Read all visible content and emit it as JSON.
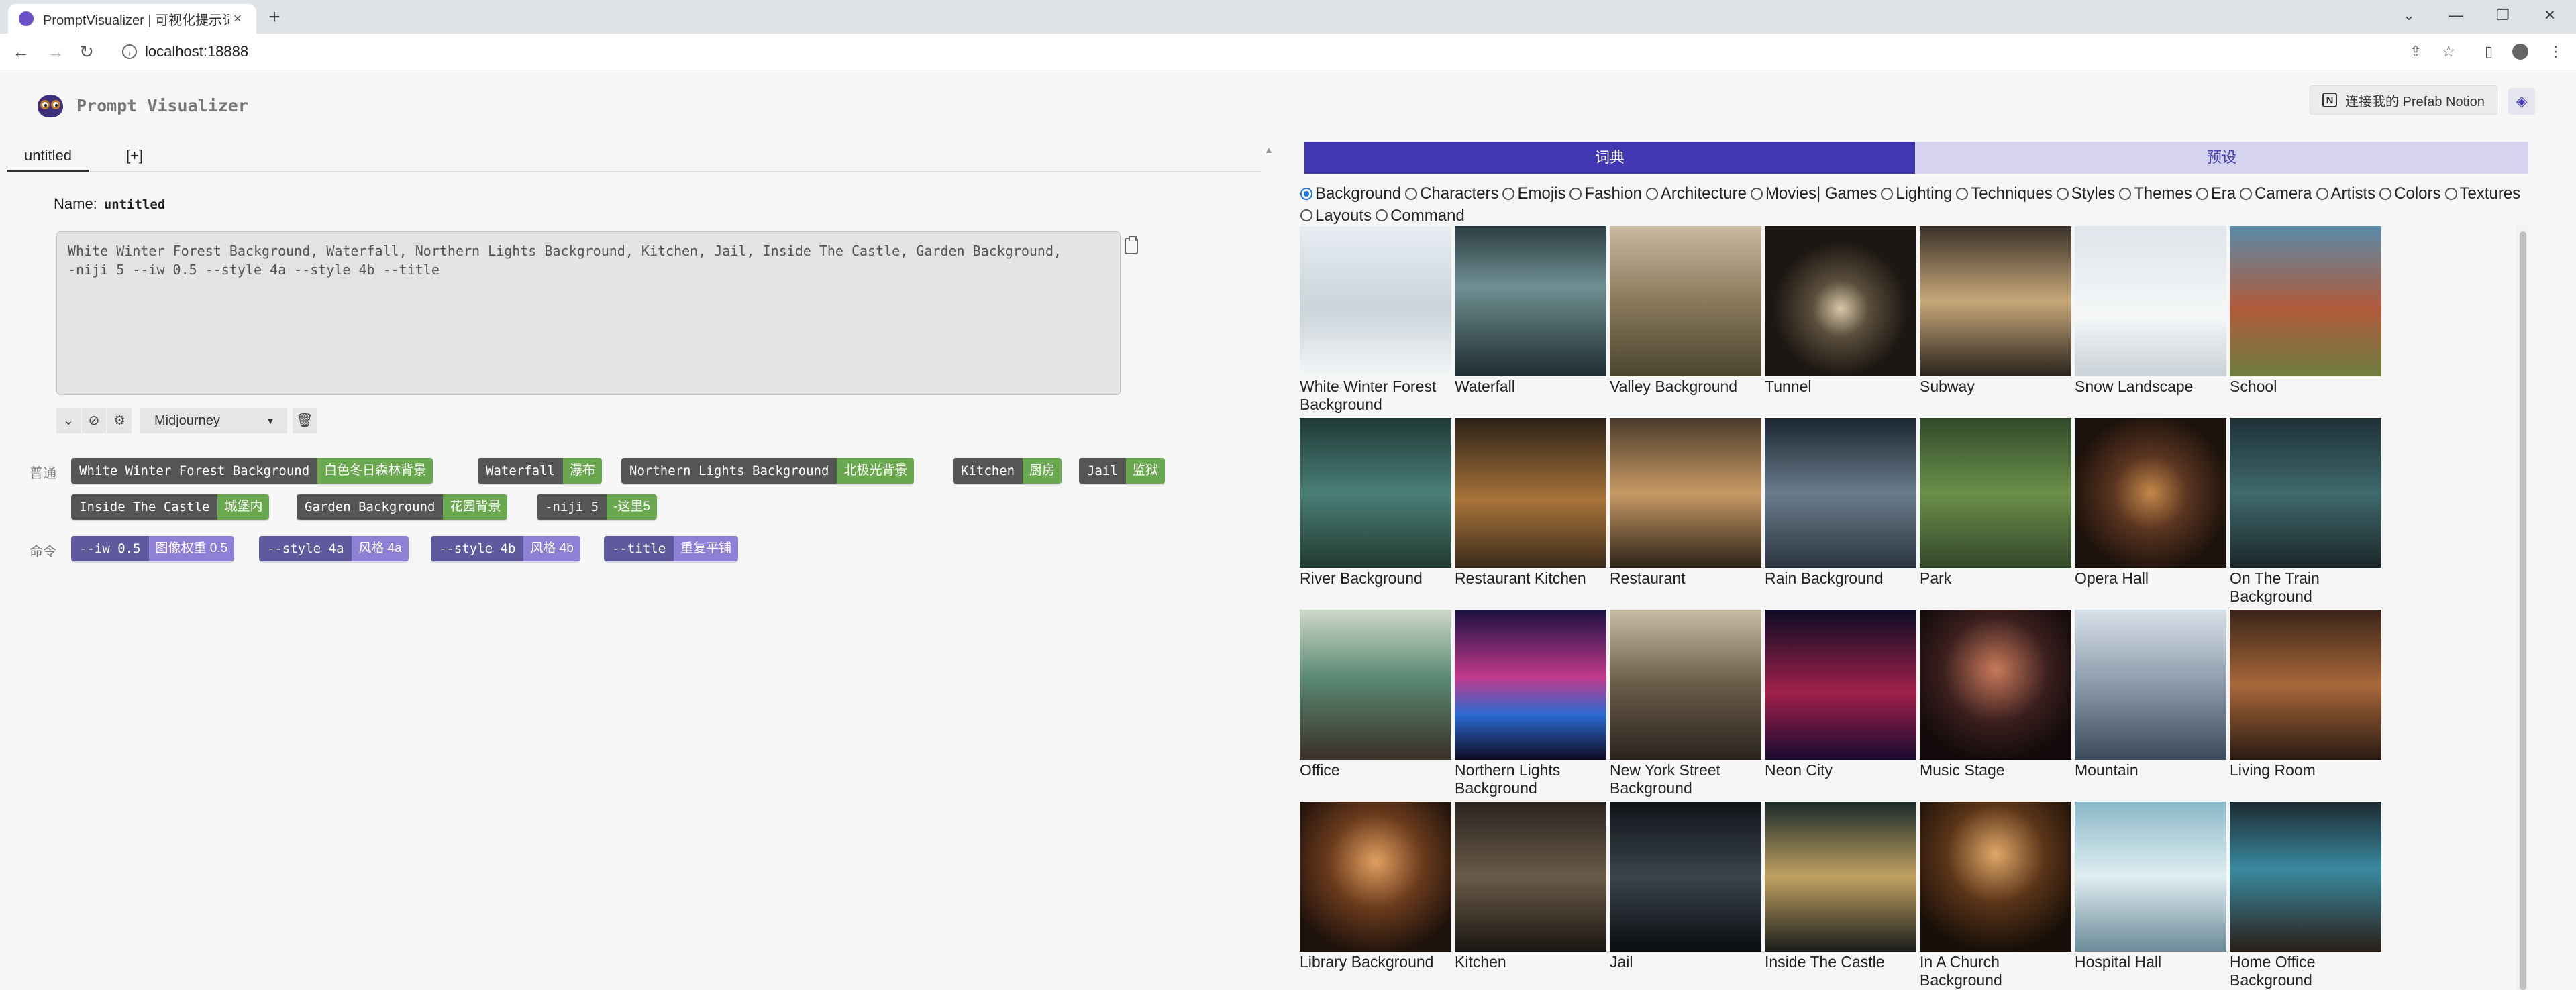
{
  "browser": {
    "tab_title": "PromptVisualizer | 可视化提示词",
    "tab_close": "×",
    "new_tab": "+",
    "url": "localhost:18888"
  },
  "app": {
    "brand": "Prompt Visualizer",
    "doc_tabs": [
      "untitled",
      "[+]"
    ],
    "name_label": "Name:",
    "name_value": "untitled",
    "prompt_text": "White Winter Forest Background, Waterfall, Northern Lights Background, Kitchen, Jail, Inside The Castle, Garden Background,\n-niji 5 --iw 0.5 --style 4a --style 4b --title",
    "model_value": "Midjourney",
    "normal_label": "普通",
    "command_label": "命令",
    "normal_chips": [
      {
        "en": "White Winter Forest Background",
        "zh": "白色冬日森林背景"
      },
      {
        "en": "Waterfall",
        "zh": "瀑布"
      },
      {
        "en": "Northern Lights Background",
        "zh": "北极光背景"
      },
      {
        "en": "Kitchen",
        "zh": "厨房"
      },
      {
        "en": "Jail",
        "zh": "监狱"
      },
      {
        "en": "Inside The Castle",
        "zh": "城堡内"
      },
      {
        "en": "Garden Background",
        "zh": "花园背景"
      },
      {
        "en": "-niji 5",
        "zh": "-这里5"
      }
    ],
    "command_chips": [
      {
        "en": "--iw 0.5",
        "zh": "图像权重 0.5"
      },
      {
        "en": "--style 4a",
        "zh": "风格 4a"
      },
      {
        "en": "--style 4b",
        "zh": "风格 4b"
      },
      {
        "en": "--title",
        "zh": "重复平铺"
      }
    ]
  },
  "right": {
    "notion_button": "连接我的 Prefab Notion",
    "segments": [
      "词典",
      "预设"
    ],
    "categories": [
      "Background",
      "Characters",
      "Emojis",
      "Fashion",
      "Architecture",
      "Movies| Games",
      "Lighting",
      "Techniques",
      "Styles",
      "Themes",
      "Era",
      "Camera",
      "Artists",
      "Colors",
      "Textures",
      "Layouts",
      "Command"
    ],
    "selected_category": "Background",
    "items": [
      "White Winter Forest Background",
      "Waterfall",
      "Valley Background",
      "Tunnel",
      "Subway",
      "Snow Landscape",
      "School",
      "River Background",
      "Restaurant Kitchen",
      "Restaurant",
      "Rain Background",
      "Park",
      "Opera Hall",
      "On The Train Background",
      "Office",
      "Northern Lights Background",
      "New York Street Background",
      "Neon City",
      "Music Stage",
      "Mountain",
      "Living Room",
      "Library Background",
      "Kitchen",
      "Jail",
      "Inside The Castle",
      "In A Church Background",
      "Hospital Hall",
      "Home Office Background"
    ]
  }
}
